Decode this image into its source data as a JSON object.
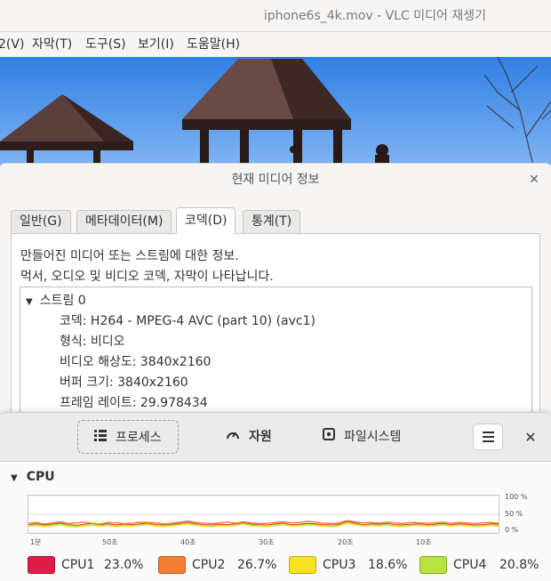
{
  "vlc": {
    "title": "iphone6s_4k.mov - VLC 미디어 재생기",
    "menu": [
      {
        "label": "2(V)",
        "name": "menu-playback"
      },
      {
        "label": "자막(T)",
        "name": "menu-subtitle"
      },
      {
        "label": "도구(S)",
        "name": "menu-tools"
      },
      {
        "label": "보기(I)",
        "name": "menu-view"
      },
      {
        "label": "도움말(H)",
        "name": "menu-help"
      }
    ]
  },
  "info_dialog": {
    "title": "현재 미디어 정보",
    "tabs": [
      "일반(G)",
      "메타데이터(M)",
      "코덱(D)",
      "통계(T)"
    ],
    "active_tab": "코덱(D)",
    "description_line1": "만들어진 미디어 또는 스트림에 대한 정보.",
    "description_line2": "먹서, 오디오 및 비디오 코덱, 자막이 나타납니다.",
    "stream_label": "스트림 0",
    "stream_rows": [
      "코덱: H264 - MPEG-4 AVC (part 10) (avc1)",
      "형식: 비디오",
      "비디오 해상도: 3840x2160",
      "버퍼 크기: 3840x2160",
      "프레임 레이트: 29.978434"
    ]
  },
  "monitor": {
    "tabs": [
      {
        "label": "프로세스",
        "icon": "list-icon"
      },
      {
        "label": "자원",
        "icon": "gauge-icon"
      },
      {
        "label": "파일시스템",
        "icon": "disk-icon"
      }
    ],
    "active_tab": "자원",
    "cpu_heading": "CPU",
    "percent_labels": [
      "100 %",
      "50 %",
      "0 %"
    ],
    "time_labels": [
      "1분",
      "50초",
      "40초",
      "30초",
      "20초",
      "10초"
    ],
    "legend": [
      {
        "name": "CPU1",
        "value": "23.0%",
        "color": "#e01b47"
      },
      {
        "name": "CPU2",
        "value": "26.7%",
        "color": "#f57c33"
      },
      {
        "name": "CPU3",
        "value": "18.6%",
        "color": "#f9e11e"
      },
      {
        "name": "CPU4",
        "value": "20.8%",
        "color": "#b6e33e"
      }
    ]
  },
  "chart_data": {
    "type": "line",
    "ylim": [
      0,
      100
    ],
    "series": [
      {
        "name": "CPU1",
        "color": "#e01b47",
        "values": [
          22,
          24,
          21,
          23,
          26,
          22,
          20,
          23,
          25,
          22,
          24,
          21,
          23,
          22,
          24,
          26,
          22,
          21,
          23,
          25,
          28,
          24,
          22,
          21,
          23,
          22,
          24,
          27,
          23,
          22,
          21,
          24,
          26,
          22,
          23,
          25,
          24,
          22,
          21,
          23,
          30,
          26,
          22,
          24,
          23,
          25,
          22,
          21,
          23,
          24,
          22,
          23,
          25,
          22,
          24,
          23,
          21,
          22,
          24,
          23
        ]
      },
      {
        "name": "CPU2",
        "color": "#f57c33",
        "values": [
          26,
          28,
          24,
          27,
          30,
          25,
          27,
          29,
          26,
          24,
          28,
          27,
          25,
          26,
          29,
          28,
          27,
          24,
          26,
          29,
          32,
          28,
          26,
          25,
          27,
          29,
          26,
          30,
          27,
          25,
          26,
          28,
          30,
          27,
          28,
          31,
          29,
          26,
          25,
          27,
          33,
          30,
          27,
          28,
          26,
          29,
          27,
          25,
          28,
          27,
          26,
          27,
          29,
          26,
          28,
          27,
          25,
          27,
          28,
          26
        ]
      },
      {
        "name": "CPU3",
        "color": "#f9e11e",
        "values": [
          18,
          20,
          17,
          19,
          22,
          18,
          16,
          19,
          21,
          18,
          20,
          17,
          19,
          18,
          20,
          22,
          18,
          17,
          19,
          21,
          24,
          20,
          18,
          17,
          19,
          18,
          20,
          23,
          19,
          18,
          17,
          20,
          22,
          18,
          19,
          21,
          20,
          18,
          17,
          19,
          26,
          22,
          18,
          20,
          19,
          21,
          18,
          17,
          19,
          20,
          18,
          19,
          21,
          18,
          20,
          19,
          17,
          18,
          20,
          18
        ]
      },
      {
        "name": "CPU4",
        "color": "#b6e33e",
        "values": [
          20,
          22,
          19,
          21,
          24,
          20,
          18,
          21,
          23,
          20,
          22,
          19,
          21,
          20,
          22,
          24,
          20,
          19,
          21,
          23,
          26,
          22,
          20,
          19,
          21,
          20,
          22,
          25,
          21,
          20,
          19,
          22,
          24,
          20,
          21,
          23,
          22,
          20,
          19,
          21,
          28,
          24,
          20,
          22,
          21,
          23,
          20,
          19,
          21,
          22,
          20,
          21,
          23,
          20,
          22,
          21,
          19,
          20,
          22,
          21
        ]
      }
    ]
  }
}
